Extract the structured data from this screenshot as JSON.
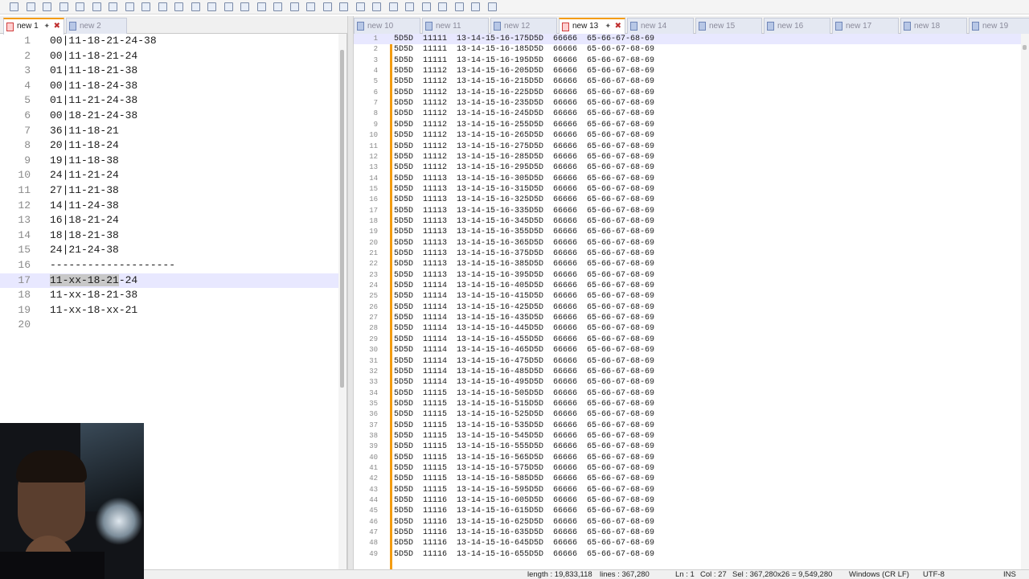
{
  "toolbar": {
    "icon_names": [
      "new-icon",
      "open-icon",
      "save-icon",
      "save-all-icon",
      "close-icon",
      "close-all-icon",
      "print-icon",
      "cut-icon",
      "copy-icon",
      "paste-icon",
      "undo-icon",
      "redo-icon",
      "find-icon",
      "replace-icon",
      "zoom-in-icon",
      "zoom-out-icon",
      "sync-vertical-icon",
      "sync-horizontal-icon",
      "word-wrap-icon",
      "show-all-chars-icon",
      "indent-guide-icon",
      "doc-map-icon",
      "function-list-icon",
      "folder-workspace-icon",
      "monitoring-icon",
      "record-macro-icon",
      "stop-macro-icon",
      "play-macro-icon",
      "run-macro-multiple-icon",
      "save-macro-icon"
    ]
  },
  "left_tabs": [
    {
      "label": "new 1",
      "active": true
    },
    {
      "label": "new 2",
      "active": false
    }
  ],
  "right_tabs": [
    {
      "label": "new 10",
      "active": false
    },
    {
      "label": "new 11",
      "active": false
    },
    {
      "label": "new 12",
      "active": false
    },
    {
      "label": "new 13",
      "active": true
    },
    {
      "label": "new 14",
      "active": false
    },
    {
      "label": "new 15",
      "active": false
    },
    {
      "label": "new 16",
      "active": false
    },
    {
      "label": "new 17",
      "active": false
    },
    {
      "label": "new 18",
      "active": false
    },
    {
      "label": "new 19",
      "active": false
    }
  ],
  "left_editor": {
    "current_line": 17,
    "selection": {
      "line": 17,
      "text": "11-xx-18-21"
    },
    "lines": [
      "00|11-18-21-24-38",
      "00|11-18-21-24",
      "01|11-18-21-38",
      "00|11-18-24-38",
      "01|11-21-24-38",
      "00|18-21-24-38",
      "36|11-18-21",
      "20|11-18-24",
      "19|11-18-38",
      "24|11-21-24",
      "27|11-21-38",
      "14|11-24-38",
      "16|18-21-24",
      "18|18-21-38",
      "24|21-24-38",
      "--------------------",
      "11-xx-18-21-24",
      "11-xx-18-21-38",
      "11-xx-18-xx-21",
      ""
    ]
  },
  "right_editor": {
    "current_line": 1,
    "lines": [
      "5D5D  11111  13-14-15-16-175D5D  66666  65-66-67-68-69",
      "5D5D  11111  13-14-15-16-185D5D  66666  65-66-67-68-69",
      "5D5D  11111  13-14-15-16-195D5D  66666  65-66-67-68-69",
      "5D5D  11112  13-14-15-16-205D5D  66666  65-66-67-68-69",
      "5D5D  11112  13-14-15-16-215D5D  66666  65-66-67-68-69",
      "5D5D  11112  13-14-15-16-225D5D  66666  65-66-67-68-69",
      "5D5D  11112  13-14-15-16-235D5D  66666  65-66-67-68-69",
      "5D5D  11112  13-14-15-16-245D5D  66666  65-66-67-68-69",
      "5D5D  11112  13-14-15-16-255D5D  66666  65-66-67-68-69",
      "5D5D  11112  13-14-15-16-265D5D  66666  65-66-67-68-69",
      "5D5D  11112  13-14-15-16-275D5D  66666  65-66-67-68-69",
      "5D5D  11112  13-14-15-16-285D5D  66666  65-66-67-68-69",
      "5D5D  11112  13-14-15-16-295D5D  66666  65-66-67-68-69",
      "5D5D  11113  13-14-15-16-305D5D  66666  65-66-67-68-69",
      "5D5D  11113  13-14-15-16-315D5D  66666  65-66-67-68-69",
      "5D5D  11113  13-14-15-16-325D5D  66666  65-66-67-68-69",
      "5D5D  11113  13-14-15-16-335D5D  66666  65-66-67-68-69",
      "5D5D  11113  13-14-15-16-345D5D  66666  65-66-67-68-69",
      "5D5D  11113  13-14-15-16-355D5D  66666  65-66-67-68-69",
      "5D5D  11113  13-14-15-16-365D5D  66666  65-66-67-68-69",
      "5D5D  11113  13-14-15-16-375D5D  66666  65-66-67-68-69",
      "5D5D  11113  13-14-15-16-385D5D  66666  65-66-67-68-69",
      "5D5D  11113  13-14-15-16-395D5D  66666  65-66-67-68-69",
      "5D5D  11114  13-14-15-16-405D5D  66666  65-66-67-68-69",
      "5D5D  11114  13-14-15-16-415D5D  66666  65-66-67-68-69",
      "5D5D  11114  13-14-15-16-425D5D  66666  65-66-67-68-69",
      "5D5D  11114  13-14-15-16-435D5D  66666  65-66-67-68-69",
      "5D5D  11114  13-14-15-16-445D5D  66666  65-66-67-68-69",
      "5D5D  11114  13-14-15-16-455D5D  66666  65-66-67-68-69",
      "5D5D  11114  13-14-15-16-465D5D  66666  65-66-67-68-69",
      "5D5D  11114  13-14-15-16-475D5D  66666  65-66-67-68-69",
      "5D5D  11114  13-14-15-16-485D5D  66666  65-66-67-68-69",
      "5D5D  11114  13-14-15-16-495D5D  66666  65-66-67-68-69",
      "5D5D  11115  13-14-15-16-505D5D  66666  65-66-67-68-69",
      "5D5D  11115  13-14-15-16-515D5D  66666  65-66-67-68-69",
      "5D5D  11115  13-14-15-16-525D5D  66666  65-66-67-68-69",
      "5D5D  11115  13-14-15-16-535D5D  66666  65-66-67-68-69",
      "5D5D  11115  13-14-15-16-545D5D  66666  65-66-67-68-69",
      "5D5D  11115  13-14-15-16-555D5D  66666  65-66-67-68-69",
      "5D5D  11115  13-14-15-16-565D5D  66666  65-66-67-68-69",
      "5D5D  11115  13-14-15-16-575D5D  66666  65-66-67-68-69",
      "5D5D  11115  13-14-15-16-585D5D  66666  65-66-67-68-69",
      "5D5D  11115  13-14-15-16-595D5D  66666  65-66-67-68-69",
      "5D5D  11116  13-14-15-16-605D5D  66666  65-66-67-68-69",
      "5D5D  11116  13-14-15-16-615D5D  66666  65-66-67-68-69",
      "5D5D  11116  13-14-15-16-625D5D  66666  65-66-67-68-69",
      "5D5D  11116  13-14-15-16-635D5D  66666  65-66-67-68-69",
      "5D5D  11116  13-14-15-16-645D5D  66666  65-66-67-68-69",
      "5D5D  11116  13-14-15-16-655D5D  66666  65-66-67-68-69"
    ]
  },
  "statusbar": {
    "length": "length : 19,833,118",
    "lines": "lines : 367,280",
    "ln": "Ln : 1",
    "col": "Col : 27",
    "sel": "Sel : 367,280x26 = 9,549,280",
    "eol": "Windows (CR LF)",
    "encoding": "UTF-8",
    "mode": "INS"
  },
  "colors": {
    "accent": "#f39c12",
    "close": "#c03030",
    "current_line": "#e8e8ff",
    "selection": "#c8c8c8"
  }
}
